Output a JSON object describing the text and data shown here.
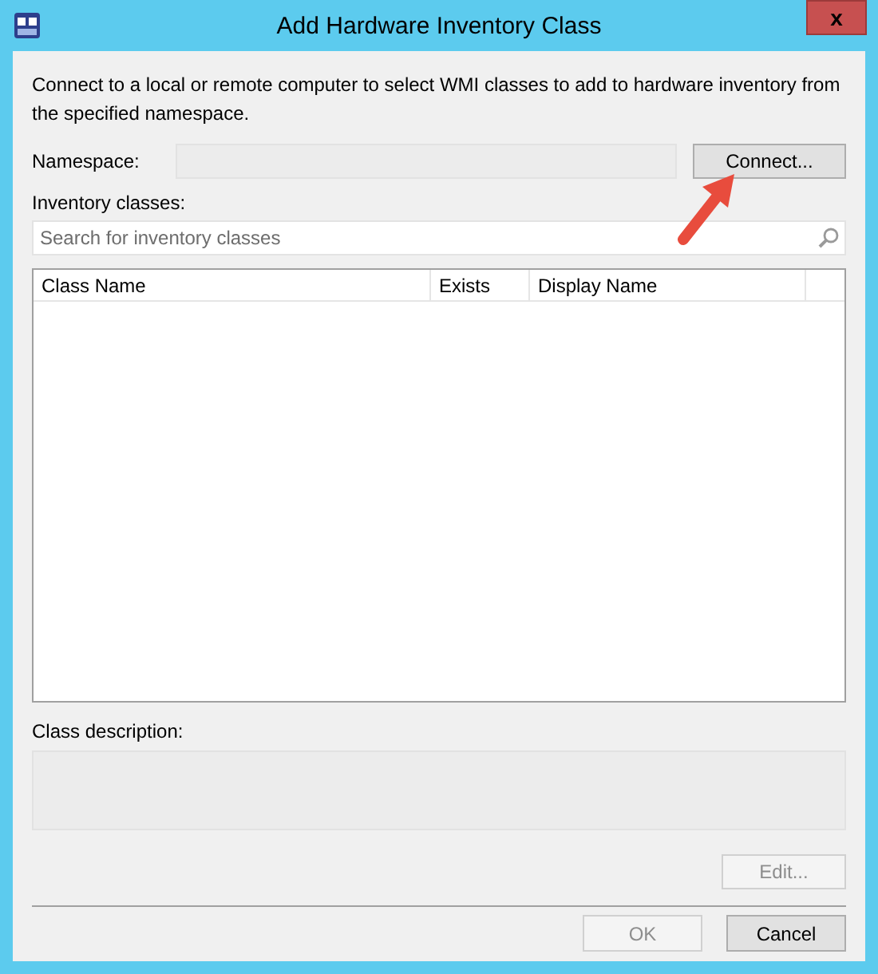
{
  "window": {
    "title": "Add Hardware Inventory Class",
    "close": "x"
  },
  "description": "Connect to a local or remote computer to select WMI classes to add to hardware inventory from the specified namespace.",
  "namespace": {
    "label": "Namespace:",
    "disabled": true,
    "button": {
      "label": "Connect...",
      "disabled": false
    }
  },
  "inventory_classes": {
    "label": "Inventory classes:",
    "search": {
      "placeholder": "Search for inventory classes"
    },
    "table": {
      "columns": [
        "Class Name",
        "Exists",
        "Display Name"
      ]
    }
  },
  "class_description": {
    "label": "Class description:",
    "disabled": true
  },
  "edit_button": {
    "label": "Edit...",
    "disabled": true
  },
  "buttons": [
    {
      "label": "OK",
      "disabled": true
    },
    {
      "label": "Cancel",
      "disabled": false
    }
  ]
}
